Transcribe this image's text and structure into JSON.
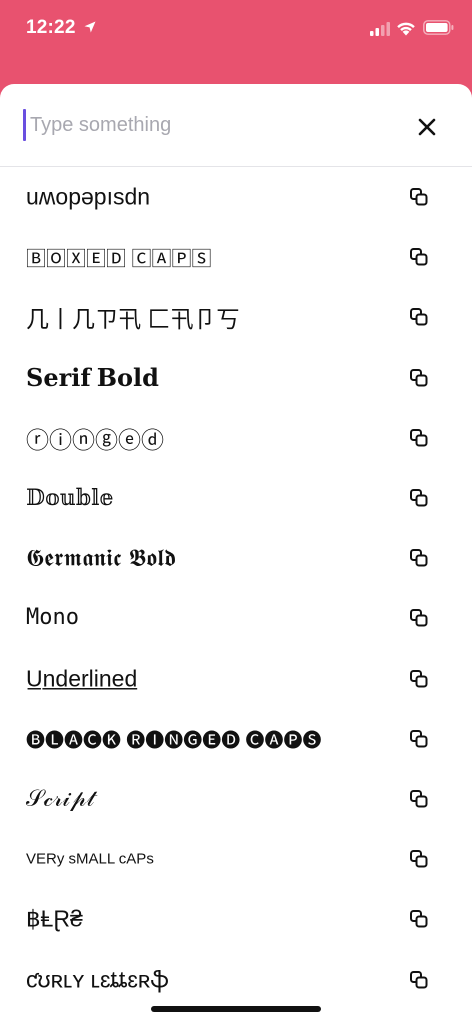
{
  "status_bar": {
    "time": "12:22"
  },
  "search": {
    "placeholder": "Type something",
    "value": ""
  },
  "icons": {
    "close": "close-icon",
    "copy": "copy-icon",
    "location": "location-arrow-icon",
    "signal": "cellular-signal-icon",
    "wifi": "wifi-icon",
    "battery": "battery-icon"
  },
  "colors": {
    "header": "#e8526f",
    "caret": "#6a4fe0"
  },
  "styles": [
    {
      "text": "uʍopəpısdn"
    },
    {
      "text": "🄱🄾🅇🄴🄳 🄲🄰🄿🅂"
    },
    {
      "text": "几丨几ㄗ卂 匚卂卩丂"
    },
    {
      "text": "𝐒𝐞𝐫𝐢𝐟 𝐁𝐨𝐥𝐝"
    },
    {
      "text": "ⓡⓘⓝⓖⓔⓓ"
    },
    {
      "text": "𝔻𝕠𝕦𝕓𝕝𝕖"
    },
    {
      "text": "𝕲𝖊𝖗𝖒𝖆𝖓𝖎𝖈 𝕭𝖔𝖑𝖉"
    },
    {
      "text": "𝙼𝚘𝚗𝚘"
    },
    {
      "text": "U̲n̲d̲e̲r̲l̲i̲n̲e̲d̲"
    },
    {
      "text": "🅑🅛🅐🅒🅚 🅡🅘🅝🅖🅔🅓 🅒🅐🅟🅢"
    },
    {
      "text": "𝒮𝒸𝓇𝒾𝓅𝓉"
    },
    {
      "text": "VERy sMALL cAPs"
    },
    {
      "text": "฿ⱠⱤ₴"
    },
    {
      "text": "ƈʊʀʟʏ ʟɛȶȶɛʀֆ"
    }
  ]
}
